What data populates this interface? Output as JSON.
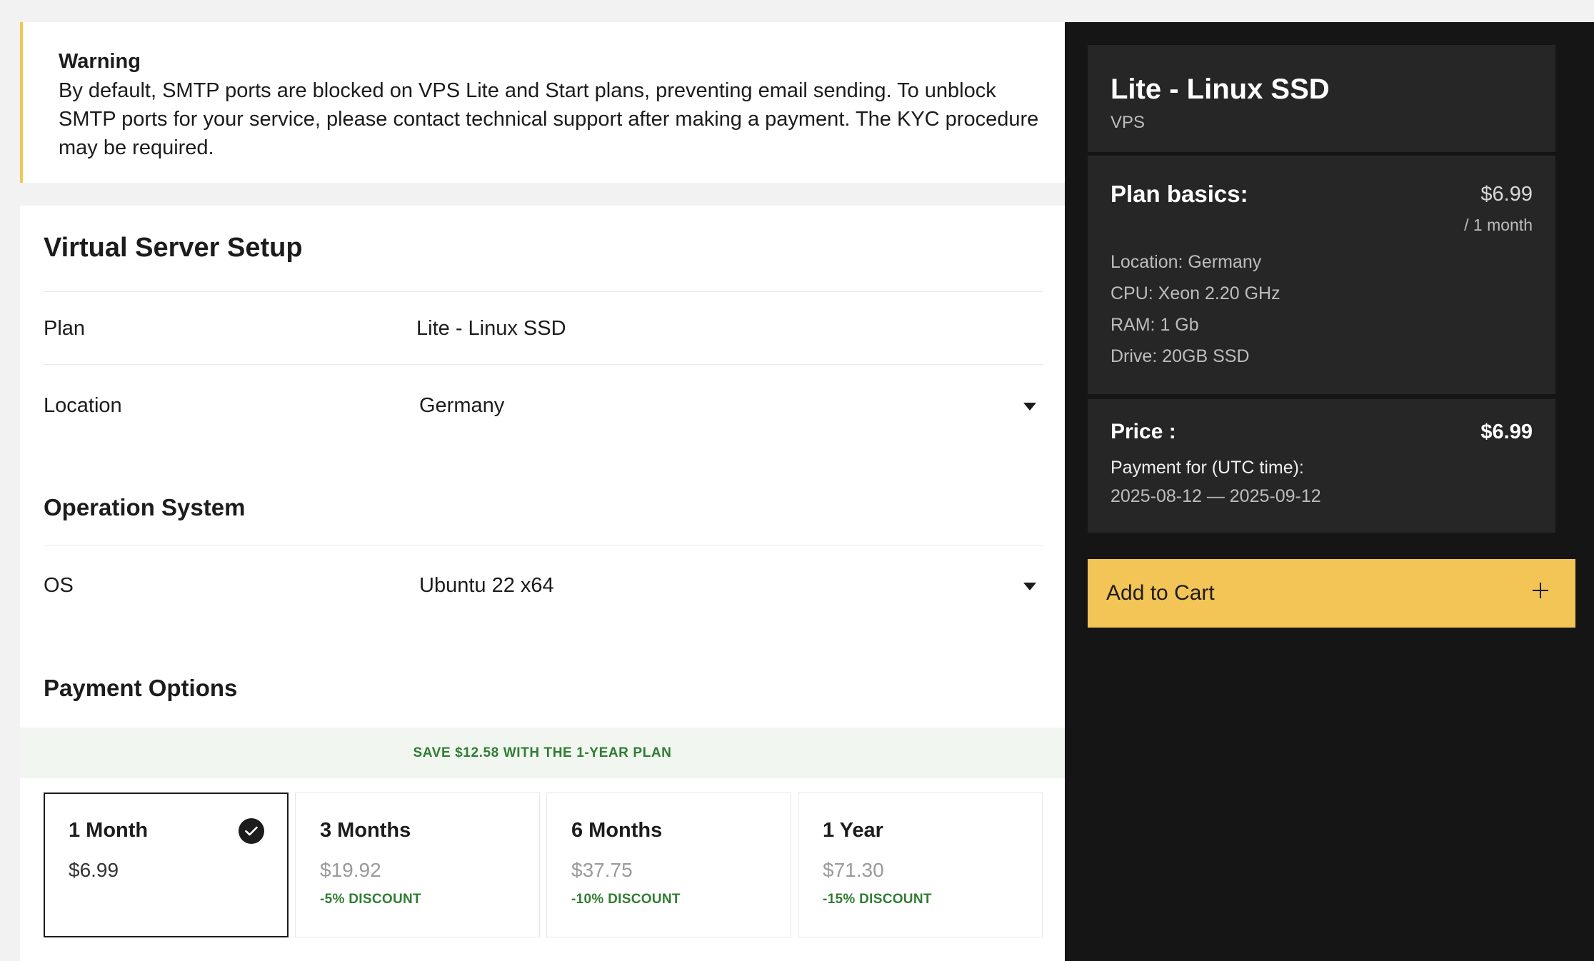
{
  "warning": {
    "title": "Warning",
    "text": "By default, SMTP ports are blocked on VPS Lite and Start plans, preventing email sending. To unblock SMTP ports for your service, please contact technical support after making a payment. The KYC procedure may be required."
  },
  "setup": {
    "title": "Virtual Server Setup",
    "plan_label": "Plan",
    "plan_value": "Lite - Linux SSD",
    "location_label": "Location",
    "location_value": "Germany",
    "os_section": "Operation System",
    "os_label": "OS",
    "os_value": "Ubuntu 22 x64",
    "payment_section": "Payment Options",
    "save_banner": "SAVE $12.58 WITH THE 1-YEAR PLAN"
  },
  "payment_options": [
    {
      "title": "1 Month",
      "price": "$6.99",
      "discount": "",
      "selected": true
    },
    {
      "title": "3 Months",
      "price": "$19.92",
      "discount": "-5% DISCOUNT",
      "selected": false
    },
    {
      "title": "6 Months",
      "price": "$37.75",
      "discount": "-10% DISCOUNT",
      "selected": false
    },
    {
      "title": "1 Year",
      "price": "$71.30",
      "discount": "-15% DISCOUNT",
      "selected": false
    }
  ],
  "summary": {
    "plan_name": "Lite - Linux SSD",
    "plan_type": "VPS",
    "basics_title": "Plan basics:",
    "basics_price": "$6.99",
    "basics_period": "/ 1 month",
    "specs": [
      "Location: Germany",
      "CPU: Xeon 2.20 GHz",
      "RAM: 1 Gb",
      "Drive: 20GB SSD"
    ],
    "price_label": "Price :",
    "price_value": "$6.99",
    "payment_for_label": "Payment for (UTC time):",
    "payment_for_dates": "2025-08-12 — 2025-09-12",
    "add_to_cart": "Add to Cart"
  },
  "colors": {
    "accent_yellow": "#f3c456",
    "discount_green": "#2f7d32",
    "sidebar_bg": "#151515",
    "sidebar_box": "#262626"
  }
}
